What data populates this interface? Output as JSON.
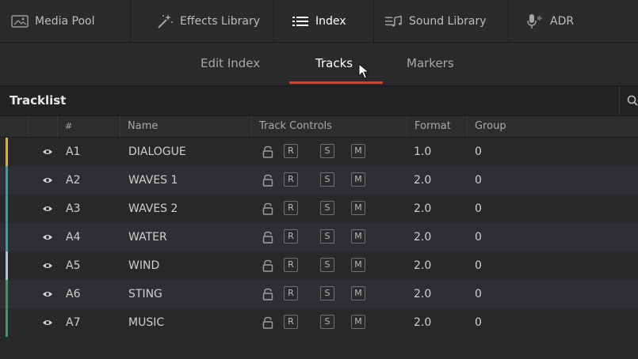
{
  "toolbar": {
    "items": [
      {
        "label": "Media Pool",
        "icon": "media-pool-icon"
      },
      {
        "label": "Effects Library",
        "icon": "effects-wand-icon"
      },
      {
        "label": "Index",
        "icon": "index-list-icon",
        "active": true
      },
      {
        "label": "Sound Library",
        "icon": "sound-library-icon"
      },
      {
        "label": "ADR",
        "icon": "microphone-icon"
      }
    ]
  },
  "subtabs": {
    "items": [
      {
        "label": "Edit Index"
      },
      {
        "label": "Tracks",
        "active": true
      },
      {
        "label": "Markers"
      }
    ]
  },
  "tracklist": {
    "title": "Tracklist",
    "columns": {
      "num": "#",
      "name": "Name",
      "controls": "Track Controls",
      "format": "Format",
      "group": "Group"
    },
    "button_labels": {
      "r": "R",
      "s": "S",
      "m": "M"
    },
    "rows": [
      {
        "num": "A1",
        "name": "DIALOGUE",
        "format": "1.0",
        "group": "0",
        "color": "#e3b41f"
      },
      {
        "num": "A2",
        "name": "WAVES 1",
        "format": "2.0",
        "group": "0",
        "color": "#2aa4a6"
      },
      {
        "num": "A3",
        "name": "WAVES 2",
        "format": "2.0",
        "group": "0",
        "color": "#2aa4a6"
      },
      {
        "num": "A4",
        "name": "WATER",
        "format": "2.0",
        "group": "0",
        "color": "#2aa4a6"
      },
      {
        "num": "A5",
        "name": "WIND",
        "format": "2.0",
        "group": "0",
        "color": "#a9c6e6"
      },
      {
        "num": "A6",
        "name": "STING",
        "format": "2.0",
        "group": "0",
        "color": "#2f9e62"
      },
      {
        "num": "A7",
        "name": "MUSIC",
        "format": "2.0",
        "group": "0",
        "color": "#2f9e62"
      }
    ]
  },
  "colors": {
    "accent_underline": "#d9402d",
    "background": "#28282b"
  }
}
